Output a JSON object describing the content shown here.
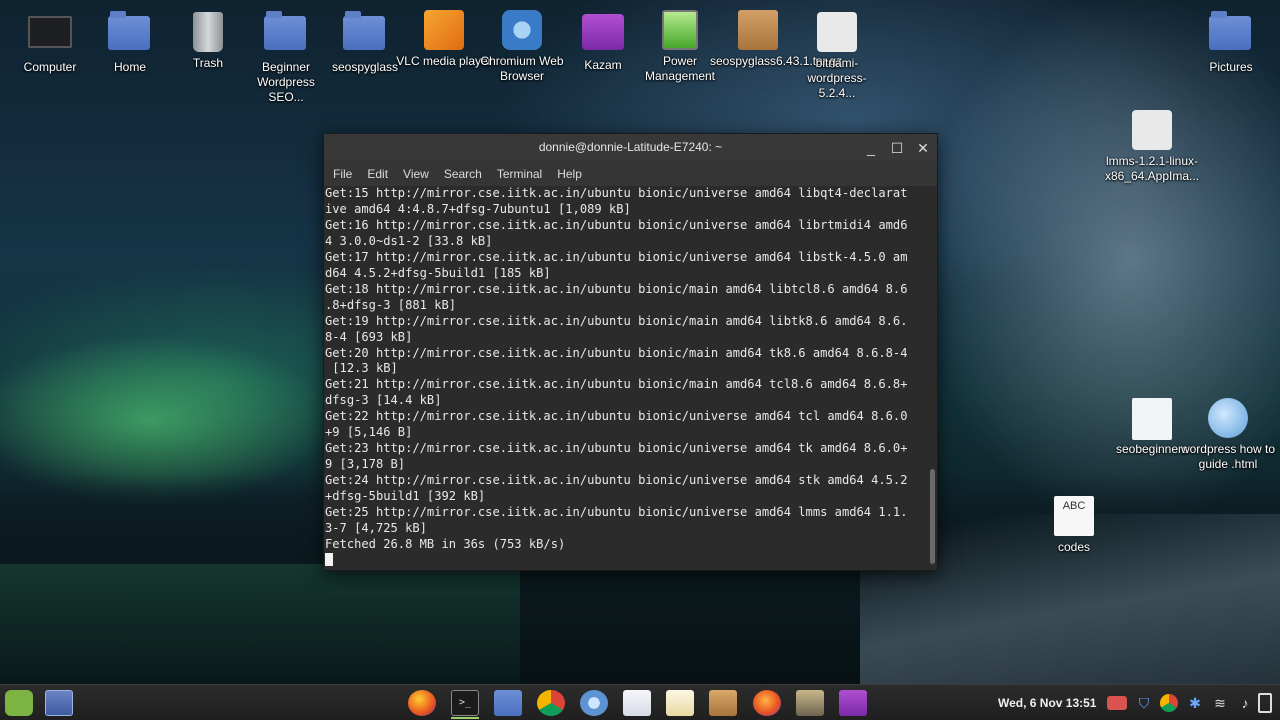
{
  "desktop": {
    "icons": [
      {
        "name": "computer",
        "label": "Computer"
      },
      {
        "name": "home",
        "label": "Home"
      },
      {
        "name": "trash",
        "label": "Trash"
      },
      {
        "name": "beginner-folder",
        "label": "Beginner Wordpress SEO..."
      },
      {
        "name": "seospyglass-folder",
        "label": "seospyglass"
      },
      {
        "name": "vlc",
        "label": "VLC media player"
      },
      {
        "name": "chromium",
        "label": "Chromium Web Browser"
      },
      {
        "name": "kazam",
        "label": "Kazam"
      },
      {
        "name": "power-management",
        "label": "Power Management"
      },
      {
        "name": "seospyglass-archive",
        "label": "seospyglass6.43.1.tar.gz"
      },
      {
        "name": "bitnami",
        "label": "bitnami-wordpress-5.2.4..."
      },
      {
        "name": "pictures",
        "label": "Pictures"
      },
      {
        "name": "lmms-appimage",
        "label": "lmms-1.2.1-linux-x86_64.AppIma..."
      },
      {
        "name": "seobeginners-doc",
        "label": "seobeginners"
      },
      {
        "name": "wordpress-html",
        "label": "wordpress how to guide .html"
      },
      {
        "name": "codes",
        "label": "codes",
        "glyph": "ABC"
      }
    ]
  },
  "terminal": {
    "title": "donnie@donnie-Latitude-E7240: ~",
    "window_buttons": {
      "minimize": "_",
      "maximize": "☐",
      "close": "✕"
    },
    "menu": [
      "File",
      "Edit",
      "View",
      "Search",
      "Terminal",
      "Help"
    ],
    "lines": [
      "Get:15 http://mirror.cse.iitk.ac.in/ubuntu bionic/universe amd64 libqt4-declarat",
      "ive amd64 4:4.8.7+dfsg-7ubuntu1 [1,089 kB]",
      "Get:16 http://mirror.cse.iitk.ac.in/ubuntu bionic/universe amd64 librtmidi4 amd6",
      "4 3.0.0~ds1-2 [33.8 kB]",
      "Get:17 http://mirror.cse.iitk.ac.in/ubuntu bionic/universe amd64 libstk-4.5.0 am",
      "d64 4.5.2+dfsg-5build1 [185 kB]",
      "Get:18 http://mirror.cse.iitk.ac.in/ubuntu bionic/main amd64 libtcl8.6 amd64 8.6",
      ".8+dfsg-3 [881 kB]",
      "Get:19 http://mirror.cse.iitk.ac.in/ubuntu bionic/main amd64 libtk8.6 amd64 8.6.",
      "8-4 [693 kB]",
      "Get:20 http://mirror.cse.iitk.ac.in/ubuntu bionic/main amd64 tk8.6 amd64 8.6.8-4",
      " [12.3 kB]",
      "Get:21 http://mirror.cse.iitk.ac.in/ubuntu bionic/main amd64 tcl8.6 amd64 8.6.8+",
      "dfsg-3 [14.4 kB]",
      "Get:22 http://mirror.cse.iitk.ac.in/ubuntu bionic/universe amd64 tcl amd64 8.6.0",
      "+9 [5,146 B]",
      "Get:23 http://mirror.cse.iitk.ac.in/ubuntu bionic/universe amd64 tk amd64 8.6.0+",
      "9 [3,178 B]",
      "Get:24 http://mirror.cse.iitk.ac.in/ubuntu bionic/universe amd64 stk amd64 4.5.2",
      "+dfsg-5build1 [392 kB]",
      "Get:25 http://mirror.cse.iitk.ac.in/ubuntu bionic/universe amd64 lmms amd64 1.1.",
      "3-7 [4,725 kB]",
      "Fetched 26.8 MB in 36s (753 kB/s)"
    ]
  },
  "taskbar": {
    "terminal_glyph": ">_",
    "clock": "Wed, 6 Nov 13:51",
    "tray": {
      "shield": "⛉",
      "bluetooth": "✱",
      "wifi": "≋",
      "sound": "♪"
    }
  },
  "colors": {
    "terminal_bg": "#2b2b2b",
    "terminal_fg": "#e8e8e8",
    "titlebar_bg": "#383838",
    "mint_green": "#7cb342"
  }
}
